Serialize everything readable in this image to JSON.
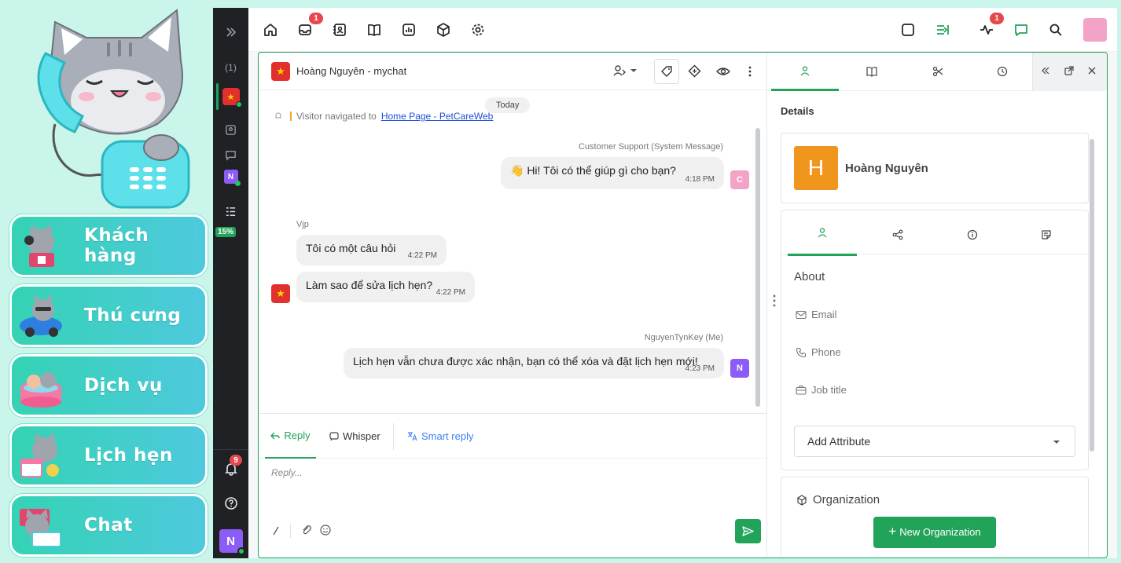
{
  "left_menu": {
    "items": [
      {
        "label": "Khách hàng",
        "icon": "cat-customer-icon"
      },
      {
        "label": "Thú cưng",
        "icon": "cat-pet-icon"
      },
      {
        "label": "Dịch vụ",
        "icon": "cat-service-icon"
      },
      {
        "label": "Lịch hẹn",
        "icon": "cat-calendar-icon"
      },
      {
        "label": "Chat",
        "icon": "cat-chat-icon"
      }
    ]
  },
  "sidebar": {
    "conversation_count": "(1)",
    "progress": "15%",
    "notification_count": "9",
    "user_initial": "N"
  },
  "topbar": {
    "inbox_badge": "1",
    "activity_badge": "1"
  },
  "chat": {
    "contact_title": "Hoàng Nguyên - mychat",
    "date_divider": "Today",
    "visitor_event_prefix": "Visitor navigated to",
    "visitor_event_link": "Home Page - PetCareWeb",
    "messages": [
      {
        "sender": "Customer Support (System Message)",
        "text": "👋 Hi! Tôi có thể giúp gì cho bạn?",
        "time": "4:18 PM",
        "avatar": "C"
      },
      {
        "sender": "Vjp",
        "text": "Tôi có một câu hỏi",
        "time": "4:22 PM"
      },
      {
        "sender": "",
        "text": "Làm sao để sửa lịch hẹn?",
        "time": "4:22 PM"
      },
      {
        "sender": "NguyenTynKey (Me)",
        "text": "Lịch hẹn vẫn chưa được xác nhận, bạn có thể xóa và đặt lịch hẹn mới!",
        "time": "4:23 PM",
        "avatar": "N"
      }
    ]
  },
  "reply": {
    "tabs": [
      "Reply",
      "Whisper",
      "Smart reply"
    ],
    "placeholder": "Reply..."
  },
  "details": {
    "heading": "Details",
    "contact_initial": "H",
    "contact_name": "Hoàng Nguyên",
    "about_heading": "About",
    "fields": [
      "Email",
      "Phone",
      "Job title"
    ],
    "add_attribute": "Add Attribute",
    "organization_heading": "Organization",
    "new_org_button": "New Organization"
  },
  "colors": {
    "brand_green": "#22a35a",
    "badge_red": "#e5484d",
    "avatar_orange": "#f0961e",
    "avatar_purple": "#8b5cf6",
    "avatar_pink": "#f3a3c8"
  }
}
